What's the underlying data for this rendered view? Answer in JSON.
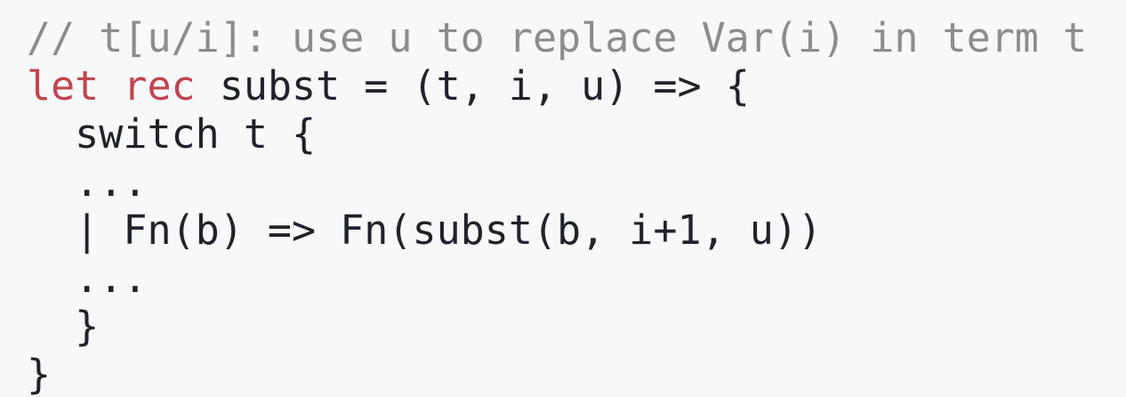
{
  "code": {
    "comment": "// t[u/i]: use u to replace Var(i) in term t",
    "line2": {
      "kw_let": "let",
      "kw_rec": "rec",
      "rest": "subst = (t, i, u) => {"
    },
    "line3": "  switch t {",
    "line4": "  ...",
    "line5": "  | Fn(b) => Fn(subst(b, i+1, u))",
    "line6": "  ...",
    "line7": "  }",
    "line8": "}"
  },
  "colors": {
    "background": "#f6f8fa",
    "comment": "#8c8c8c",
    "keyword": "#c0454f",
    "text": "#1f2328"
  }
}
